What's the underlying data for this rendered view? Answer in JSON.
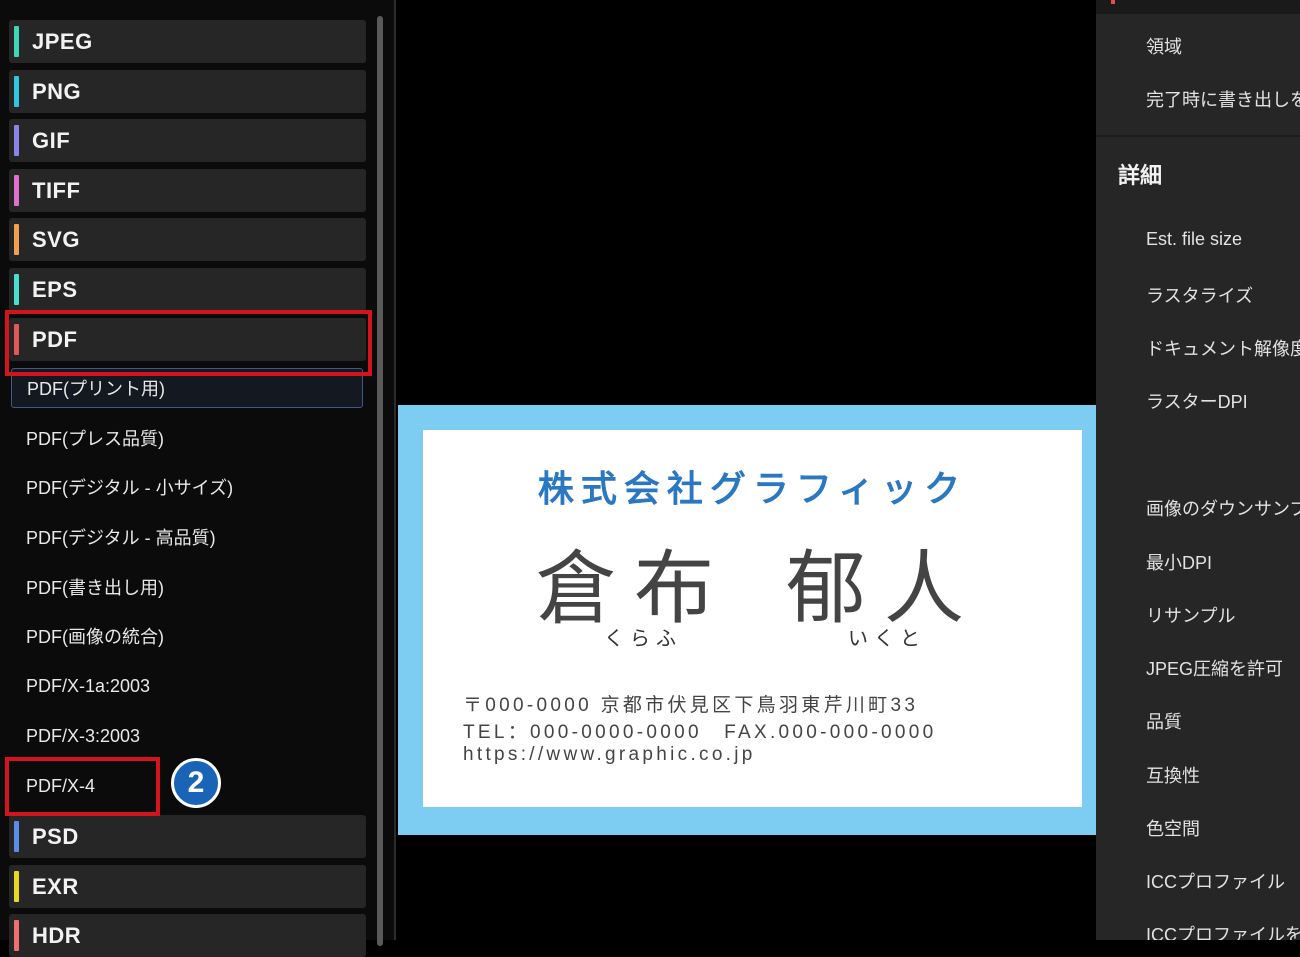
{
  "formats_top": [
    {
      "label": "JPEG",
      "color": "#3fd6b4"
    },
    {
      "label": "PNG",
      "color": "#2fc6e0"
    },
    {
      "label": "GIF",
      "color": "#8a86e8"
    },
    {
      "label": "TIFF",
      "color": "#e070d0"
    },
    {
      "label": "SVG",
      "color": "#f0a050"
    },
    {
      "label": "EPS",
      "color": "#48e0d0"
    },
    {
      "label": "PDF",
      "color": "#e05858"
    }
  ],
  "pdf_presets": [
    {
      "label": "PDF(プリント用)",
      "selected": true
    },
    {
      "label": "PDF(プレス品質)",
      "selected": false
    },
    {
      "label": "PDF(デジタル - 小サイズ)",
      "selected": false
    },
    {
      "label": "PDF(デジタル - 高品質)",
      "selected": false
    },
    {
      "label": "PDF(書き出し用)",
      "selected": false
    },
    {
      "label": "PDF(画像の統合)",
      "selected": false
    },
    {
      "label": "PDF/X-1a:2003",
      "selected": false
    },
    {
      "label": "PDF/X-3:2003",
      "selected": false
    },
    {
      "label": "PDF/X-4",
      "selected": false
    }
  ],
  "formats_bottom": [
    {
      "label": "PSD",
      "color": "#5b8de8"
    },
    {
      "label": "EXR",
      "color": "#e8d820"
    },
    {
      "label": "HDR",
      "color": "#f07070"
    }
  ],
  "step_badge": "2",
  "card": {
    "company": "株式会社グラフィック",
    "surname": "倉布",
    "given_name": "郁人",
    "surname_reading": "くらふ",
    "given_reading": "いくと",
    "address": "〒000-0000 京都市伏見区下鳥羽東芹川町33",
    "phone_fax": "TEL：000-0000-0000　FAX.000-000-0000",
    "url": "https://www.graphic.co.jp"
  },
  "right_panel": {
    "top_items": [
      "領域",
      "完了時に書き出しを"
    ],
    "section_title": "詳細",
    "details": [
      "Est. file size",
      "ラスタライズ",
      "ドキュメント解像度",
      "ラスターDPI",
      "画像のダウンサンプル",
      "最小DPI",
      "リサンプル",
      "JPEG圧縮を許可",
      "品質",
      "互換性",
      "色空間",
      "ICCプロファイル",
      "ICCプロファイルを"
    ]
  }
}
